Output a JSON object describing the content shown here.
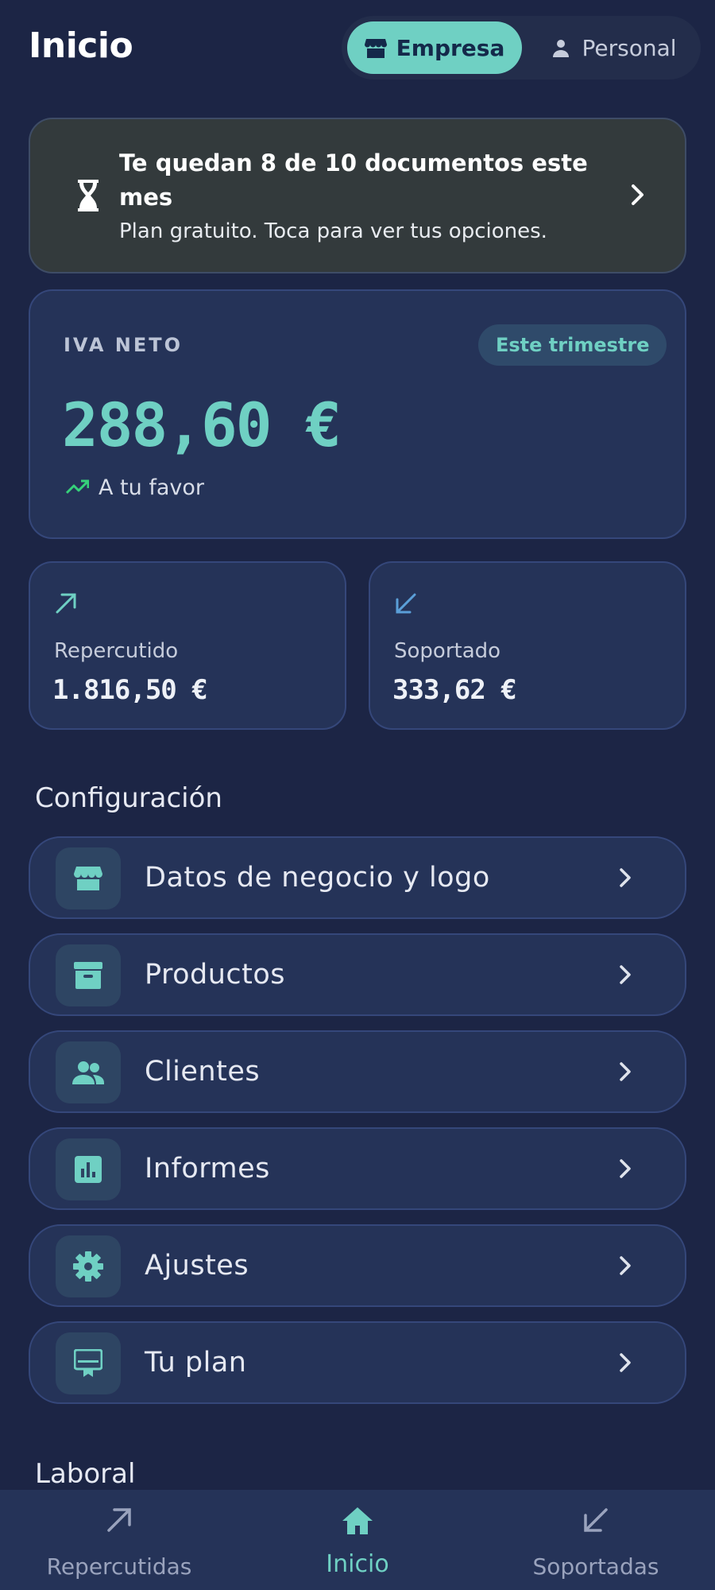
{
  "header": {
    "title": "Inicio",
    "toggle": {
      "business": "Empresa",
      "personal": "Personal",
      "selected": "Empresa"
    }
  },
  "quota_banner": {
    "title": "Te quedan 8 de 10 documentos este mes",
    "subtitle": "Plan gratuito. Toca para ver tus opciones."
  },
  "iva_card": {
    "label": "IVA NETO",
    "period": "Este trimestre",
    "amount": "288,60 €",
    "trend": "A tu favor"
  },
  "summary": [
    {
      "label": "Repercutido",
      "value": "1.816,50 €",
      "icon": "arrow-up-right-icon"
    },
    {
      "label": "Soportado",
      "value": "333,62 €",
      "icon": "arrow-down-left-icon"
    }
  ],
  "config": {
    "title": "Configuración",
    "items": [
      {
        "label": "Datos de negocio y logo",
        "icon": "storefront-icon"
      },
      {
        "label": "Productos",
        "icon": "archive-box-icon"
      },
      {
        "label": "Clientes",
        "icon": "people-icon"
      },
      {
        "label": "Informes",
        "icon": "bar-chart-icon"
      },
      {
        "label": "Ajustes",
        "icon": "gear-icon"
      },
      {
        "label": "Tu plan",
        "icon": "card-membership-icon"
      }
    ]
  },
  "laboral": {
    "title": "Laboral"
  },
  "nav": {
    "items": [
      {
        "label": "Repercutidas",
        "icon": "arrow-up-right-icon"
      },
      {
        "label": "Inicio",
        "icon": "home-icon"
      },
      {
        "label": "Soportadas",
        "icon": "arrow-down-left-icon"
      }
    ],
    "active": "Inicio"
  },
  "colors": {
    "background": "#1c2545",
    "card": "#253358",
    "accent": "#6fd0c3",
    "banner": "#333a3c",
    "trend_up": "#36d17a",
    "soportado_arrow": "#5b9fd8"
  }
}
